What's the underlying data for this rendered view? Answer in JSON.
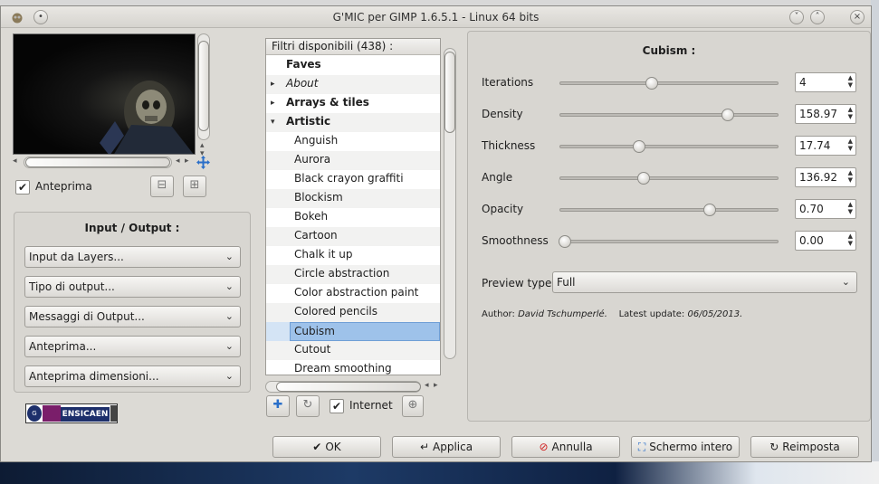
{
  "window": {
    "title": "G'MIC per GIMP 1.6.5.1 - Linux 64 bits"
  },
  "preview": {
    "checkbox_label": "Anteprima",
    "checked": true
  },
  "io_panel": {
    "title": "Input / Output :",
    "combos": [
      {
        "value": "Input da Layers..."
      },
      {
        "value": "Tipo di output..."
      },
      {
        "value": "Messaggi di Output..."
      },
      {
        "value": "Anteprima..."
      },
      {
        "value": "Anteprima dimensioni..."
      }
    ]
  },
  "logo": {
    "text": "ENSICAEN",
    "mark": "GREYC"
  },
  "filters": {
    "header": "Filtri disponibili (438) :",
    "rows": [
      {
        "label": "Faves",
        "kind": "category",
        "expander": ""
      },
      {
        "label": "About",
        "kind": "italic",
        "expander": "▸"
      },
      {
        "label": "Arrays & tiles",
        "kind": "category",
        "expander": "▸"
      },
      {
        "label": "Artistic",
        "kind": "category",
        "expander": "▾"
      },
      {
        "label": "Anguish",
        "kind": "item"
      },
      {
        "label": "Aurora",
        "kind": "item"
      },
      {
        "label": "Black crayon graffiti",
        "kind": "item"
      },
      {
        "label": "Blockism",
        "kind": "item"
      },
      {
        "label": "Bokeh",
        "kind": "item"
      },
      {
        "label": "Cartoon",
        "kind": "item"
      },
      {
        "label": "Chalk it up",
        "kind": "item"
      },
      {
        "label": "Circle abstraction",
        "kind": "item"
      },
      {
        "label": "Color abstraction paint",
        "kind": "item"
      },
      {
        "label": "Colored pencils",
        "kind": "item"
      },
      {
        "label": "Cubism",
        "kind": "item",
        "selected": true
      },
      {
        "label": "Cutout",
        "kind": "item"
      },
      {
        "label": "Dream smoothing",
        "kind": "item"
      }
    ],
    "internet_label": "Internet",
    "internet_checked": true
  },
  "settings": {
    "title": "Cubism :",
    "params": [
      {
        "label": "Iterations",
        "value": "4",
        "fraction": 0.42
      },
      {
        "label": "Density",
        "value": "158.97",
        "fraction": 0.79
      },
      {
        "label": "Thickness",
        "value": "17.74",
        "fraction": 0.36
      },
      {
        "label": "Angle",
        "value": "136.92",
        "fraction": 0.38
      },
      {
        "label": "Opacity",
        "value": "0.70",
        "fraction": 0.7
      },
      {
        "label": "Smoothness",
        "value": "0.00",
        "fraction": 0.0
      }
    ],
    "preview_type_label": "Preview type",
    "preview_type_value": "Full",
    "author_label": "Author:",
    "author_name": "David Tschumperlé.",
    "update_label": "Latest update:",
    "update_date": "06/05/2013."
  },
  "buttons": {
    "ok": "OK",
    "apply": "Applica",
    "cancel": "Annulla",
    "fullscreen": "Schermo intero",
    "reset": "Reimposta"
  },
  "colors": {
    "window_bg": "#dcdad5",
    "selection": "#9ec2ea",
    "cancel_icon": "#d12020",
    "add_icon": "#2a6fc9"
  }
}
